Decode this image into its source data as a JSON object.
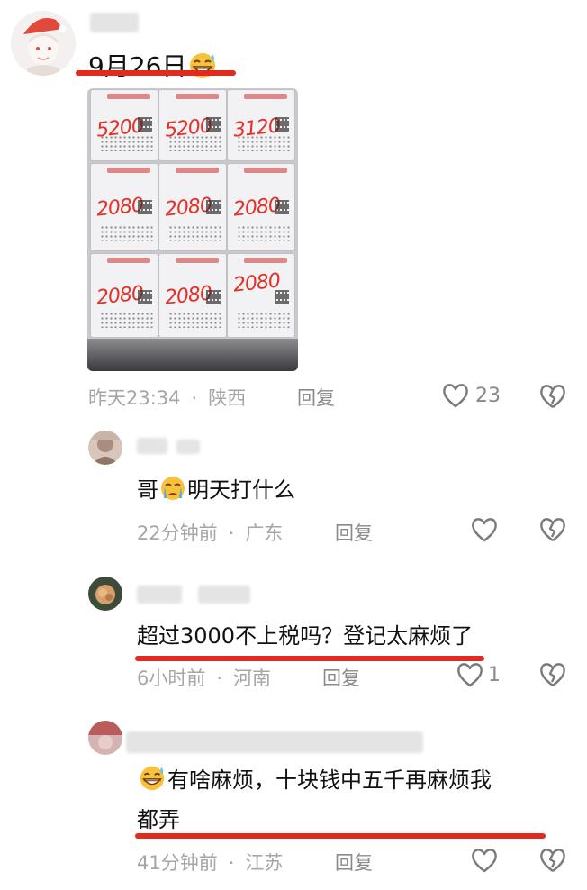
{
  "post": {
    "date_text": "9月26日",
    "emoji": "grinning-sweat-emoji",
    "photo_alt_amounts": [
      "5200",
      "5200",
      "3120",
      "2080",
      "2080",
      "2080",
      "2080",
      "2080",
      "2080"
    ],
    "time": "昨天23:34",
    "location": "陕西",
    "reply_label": "回复",
    "likes": "23"
  },
  "comments": [
    {
      "text_before": "哥",
      "emoji": "crying-emoji",
      "text_after": "明天打什么",
      "time": "22分钟前",
      "location": "广东",
      "reply_label": "回复",
      "likes": ""
    },
    {
      "text": "超过3000不上税吗？登记太麻烦了",
      "time": "6小时前",
      "location": "河南",
      "reply_label": "回复",
      "likes": "1"
    },
    {
      "emoji": "grinning-sweat-emoji",
      "text_line1": "有啥麻烦，十块钱中五千再麻烦我",
      "text_line2": "都弄",
      "time": "41分钟前",
      "location": "江苏",
      "reply_label": "回复",
      "likes": ""
    }
  ],
  "dot_separator": "·",
  "colors": {
    "underline": "#e32a1e",
    "meta": "#a6a6a6",
    "amount": "#e2322a"
  }
}
